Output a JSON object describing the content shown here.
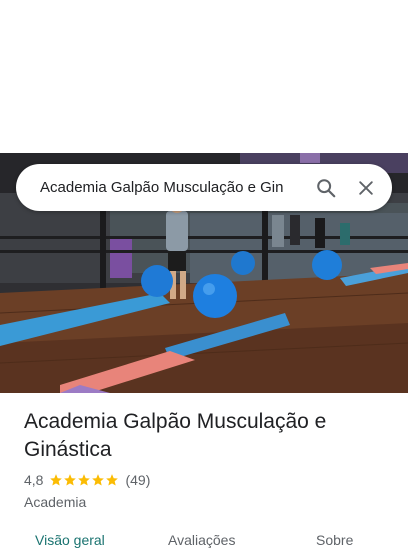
{
  "search": {
    "query": "Academia Galpão Musculação e Gin"
  },
  "place": {
    "name": "Academia Galpão Musculação e Ginástica",
    "rating": "4,8",
    "rating_value": 4.8,
    "stars_max": 5,
    "review_count": "(49)",
    "category": "Academia"
  },
  "tabs": [
    {
      "label": "Visão geral",
      "active": true
    },
    {
      "label": "Avaliações",
      "active": false
    },
    {
      "label": "Sobre",
      "active": false
    }
  ],
  "icons": {
    "search": "search-icon",
    "close": "close-icon",
    "star": "star-icon"
  },
  "colors": {
    "star": "#fbbc04",
    "active_tab": "#1a7370",
    "secondary_text": "#5f6368"
  }
}
